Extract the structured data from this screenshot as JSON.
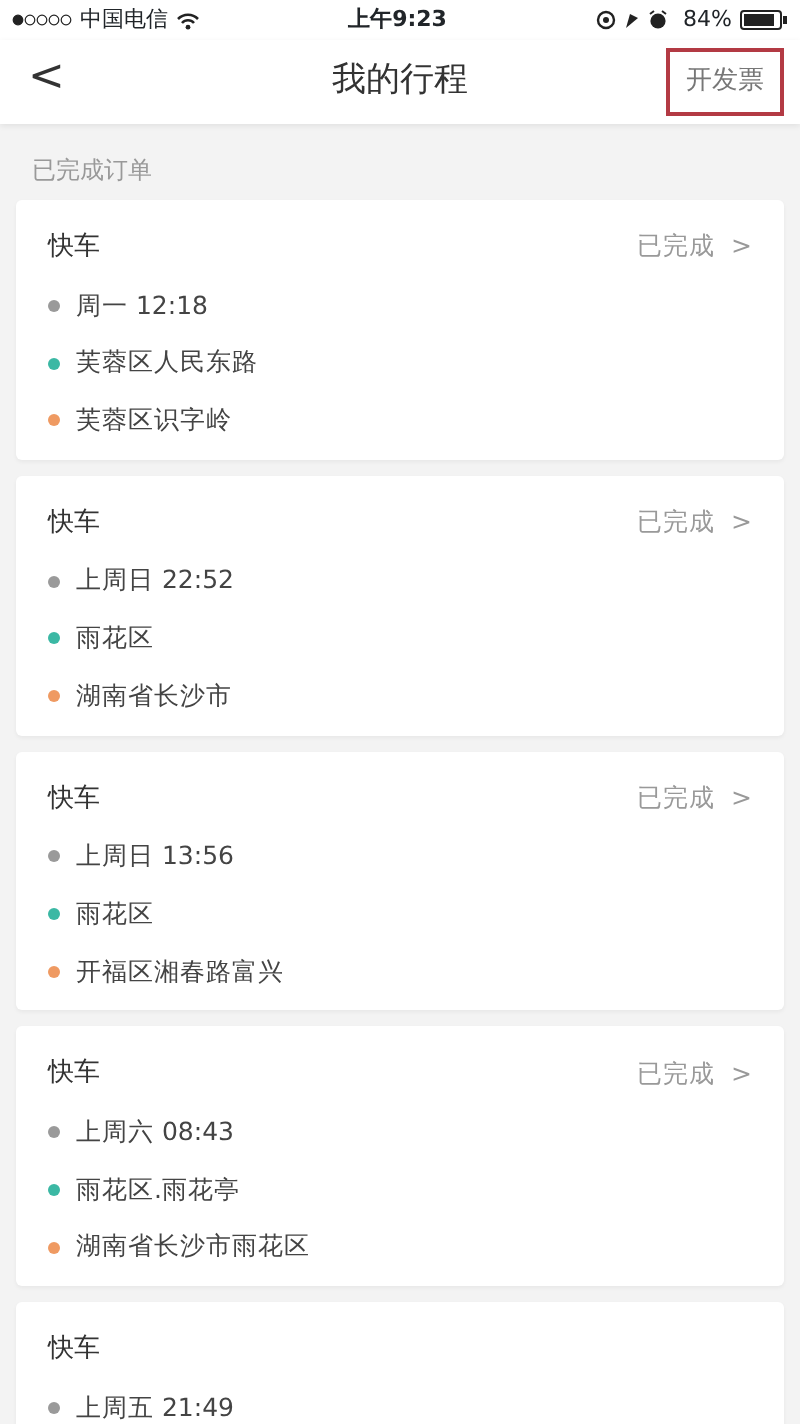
{
  "status_bar": {
    "carrier": "中国电信",
    "time": "上午9:23",
    "battery": "84%"
  },
  "nav": {
    "back": "<",
    "title": "我的行程",
    "action": {
      "label": "开发票",
      "highlighted": true
    }
  },
  "section_label": "已完成订单",
  "orders": [
    {
      "type": "快车",
      "status": "已完成",
      "chevron": ">",
      "lines": [
        {
          "text": "周一 12:18",
          "color": "#9a9a9a"
        },
        {
          "text": "芙蓉区人民东路",
          "color": "#3bb8a4"
        },
        {
          "text": "芙蓉区识字岭",
          "color": "#ef9a62"
        }
      ]
    },
    {
      "type": "快车",
      "status": "已完成",
      "chevron": ">",
      "lines": [
        {
          "text": "上周日 22:52",
          "color": "#9a9a9a"
        },
        {
          "text": "雨花区",
          "color": "#3bb8a4"
        },
        {
          "text": "湖南省长沙市",
          "color": "#ef9a62"
        }
      ]
    },
    {
      "type": "快车",
      "status": "已完成",
      "chevron": ">",
      "lines": [
        {
          "text": "上周日 13:56",
          "color": "#9a9a9a"
        },
        {
          "text": "雨花区",
          "color": "#3bb8a4"
        },
        {
          "text": "开福区湘春路富兴",
          "color": "#ef9a62"
        }
      ]
    },
    {
      "type": "快车",
      "status": "已完成",
      "chevron": ">",
      "lines": [
        {
          "text": "上周六 08:43",
          "color": "#9a9a9a"
        },
        {
          "text": "雨花区.雨花亭",
          "color": "#3bb8a4"
        },
        {
          "text": "湖南省长沙市雨花区",
          "color": "#ef9a62"
        }
      ]
    },
    {
      "type": "快车",
      "lines": [
        {
          "text": "上周五 21:49",
          "color": "#9a9a9a"
        }
      ]
    }
  ]
}
